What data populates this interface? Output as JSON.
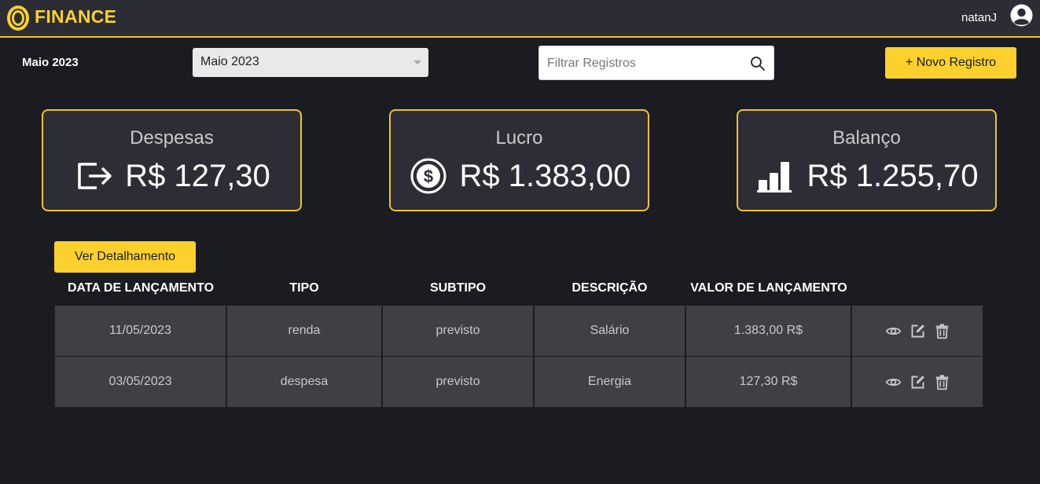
{
  "header": {
    "brand": "FINANCE",
    "username": "natanJ",
    "accent_color": "#fcd12e",
    "logo_icon": "coin-icon",
    "avatar_icon": "user-avatar-icon"
  },
  "toolbar": {
    "month_label": "Maio 2023",
    "month_select_value": "Maio 2023",
    "search_placeholder": "Filtrar Registros",
    "search_icon": "search-icon",
    "new_record_label": "+ Novo Registro"
  },
  "cards": [
    {
      "title": "Despesas",
      "value": "R$ 127,30",
      "icon": "logout-icon"
    },
    {
      "title": "Lucro",
      "value": "R$ 1.383,00",
      "icon": "dollar-coin-icon"
    },
    {
      "title": "Balanço",
      "value": "R$ 1.255,70",
      "icon": "bar-chart-icon"
    }
  ],
  "detail_button_label": "Ver Detalhamento",
  "table": {
    "headers": [
      "DATA DE LANÇAMENTO",
      "TIPO",
      "SUBTIPO",
      "DESCRIÇÃO",
      "VALOR DE LANÇAMENTO"
    ],
    "rows": [
      {
        "date": "11/05/2023",
        "type": "renda",
        "subtype": "previsto",
        "description": "Salário",
        "value": "1.383,00 R$"
      },
      {
        "date": "03/05/2023",
        "type": "despesa",
        "subtype": "previsto",
        "description": "Energia",
        "value": "127,30 R$"
      }
    ],
    "row_actions": [
      "eye-icon",
      "edit-icon",
      "trash-icon"
    ]
  }
}
